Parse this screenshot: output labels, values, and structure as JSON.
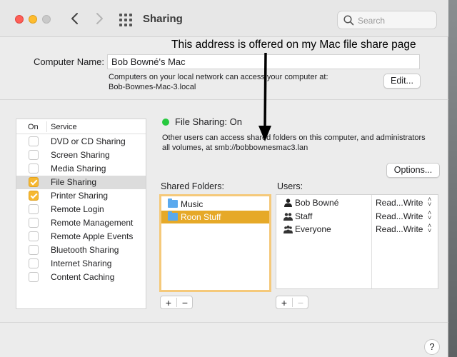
{
  "window": {
    "title": "Sharing",
    "search_placeholder": "Search"
  },
  "annotation": {
    "text": "This address is offered on my Mac file share page"
  },
  "computer": {
    "label": "Computer Name:",
    "value": "Bob Bowné's Mac",
    "info_line1": "Computers on your local network can access your computer at:",
    "info_line2": "Bob-Bownes-Mac-3.local",
    "edit_label": "Edit..."
  },
  "services": {
    "col_on": "On",
    "col_service": "Service",
    "items": [
      {
        "label": "DVD or CD Sharing",
        "on": false
      },
      {
        "label": "Screen Sharing",
        "on": false
      },
      {
        "label": "Media Sharing",
        "on": false
      },
      {
        "label": "File Sharing",
        "on": true
      },
      {
        "label": "Printer Sharing",
        "on": true
      },
      {
        "label": "Remote Login",
        "on": false
      },
      {
        "label": "Remote Management",
        "on": false
      },
      {
        "label": "Remote Apple Events",
        "on": false
      },
      {
        "label": "Bluetooth Sharing",
        "on": false
      },
      {
        "label": "Internet Sharing",
        "on": false
      },
      {
        "label": "Content Caching",
        "on": false
      }
    ],
    "selected_index": 3
  },
  "file_sharing": {
    "status": "File Sharing: On",
    "status_color": "#27c93f",
    "desc_line1": "Other users can access shared folders on this computer, and administrators",
    "desc_line2": "all volumes, at smb://bobbownesmac3.lan",
    "options_label": "Options...",
    "shared_folders_label": "Shared Folders:",
    "users_label": "Users:",
    "folders": [
      {
        "label": "Music"
      },
      {
        "label": "Roon Stuff"
      }
    ],
    "selected_folder_index": 1,
    "users": [
      {
        "name": "Bob Bowné",
        "permission": "Read...Write",
        "icon": "single-user-icon"
      },
      {
        "name": "Staff",
        "permission": "Read...Write",
        "icon": "group-icon"
      },
      {
        "name": "Everyone",
        "permission": "Read...Write",
        "icon": "everyone-icon"
      }
    ],
    "plus": "+",
    "minus": "−"
  },
  "help_label": "?",
  "colors": {
    "accent": "#e6a928",
    "checkbox_on": "#f6b831",
    "folder": "#5aa9ee"
  }
}
